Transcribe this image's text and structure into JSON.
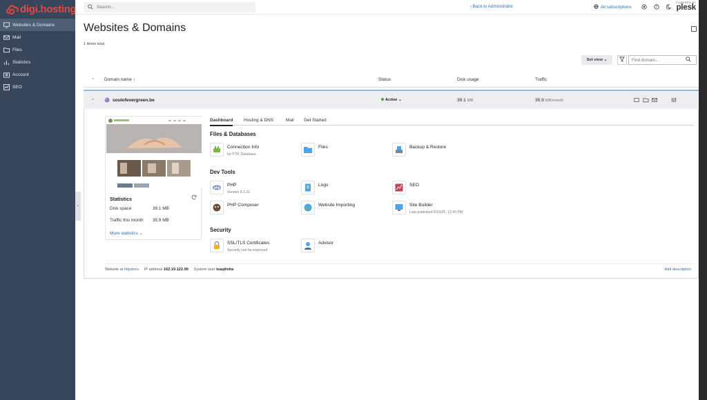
{
  "brand": {
    "name": "digi.hosting",
    "color": "#e6473f"
  },
  "sidebar": {
    "items": [
      {
        "label": "Websites & Domains",
        "icon": "monitor-icon",
        "active": true
      },
      {
        "label": "Mail",
        "icon": "mail-icon"
      },
      {
        "label": "Files",
        "icon": "folder-icon"
      },
      {
        "label": "Statistics",
        "icon": "bar-chart-icon"
      },
      {
        "label": "Account",
        "icon": "account-icon"
      },
      {
        "label": "SEO",
        "icon": "seo-icon"
      }
    ]
  },
  "topbar": {
    "search_placeholder": "Search...",
    "back_link": "‹ Back to Administrator",
    "all_subscriptions": "All subscriptions",
    "powered_by": "POWERED BY",
    "plesk": "plesk"
  },
  "page": {
    "title": "Websites & Domains",
    "items_total": "1 items total",
    "set_view": "Set view ⌄",
    "find_placeholder": "Find domain..."
  },
  "table": {
    "headers": {
      "domain": "Domain name ↑",
      "status": "Status",
      "disk": "Disk usage",
      "traffic": "Traffic"
    },
    "row": {
      "domain": "soulofevergreen.be",
      "status": "Active ⌄",
      "disk_value": "39.1",
      "disk_unit": "MB",
      "traffic_value": "35.9",
      "traffic_unit": "MB/month"
    }
  },
  "statistics": {
    "title": "Statistics",
    "disk_label": "Disk space",
    "disk_value": "39.1 MB",
    "traffic_label": "Traffic this month",
    "traffic_value": "35.9 MB",
    "more": "More statistics ⌄"
  },
  "tabs": [
    "Dashboard",
    "Hosting & DNS",
    "Mail",
    "Get Started"
  ],
  "sections": {
    "files_db": "Files & Databases",
    "dev_tools": "Dev Tools",
    "security": "Security"
  },
  "tools": {
    "connection_info": {
      "name": "Connection Info",
      "sub": "for FTP, Database"
    },
    "files": {
      "name": "Files"
    },
    "backup": {
      "name": "Backup & Restore"
    },
    "php": {
      "name": "PHP",
      "sub": "Version 8.3.21"
    },
    "logs": {
      "name": "Logs"
    },
    "seo": {
      "name": "SEO"
    },
    "php_composer": {
      "name": "PHP Composer"
    },
    "website_importing": {
      "name": "Website Importing"
    },
    "site_builder": {
      "name": "Site Builder",
      "sub": "Last published 5/15/25, 12:49 PM"
    },
    "ssl": {
      "name": "SSL/TLS Certificates",
      "sub": "Security can be improved"
    },
    "advisor": {
      "name": "Advisor"
    }
  },
  "footer": {
    "website_at_label": "Website at",
    "website_at_value": "httpdocs",
    "ip_label": "IP address",
    "ip_value": "162.19.122.90",
    "user_label": "System user",
    "user_value": "toaqfmha",
    "add_description": "Add description"
  },
  "colors": {
    "sidebar": "#37465a",
    "link": "#2b6fb4",
    "active_status": "#5aa02c"
  }
}
